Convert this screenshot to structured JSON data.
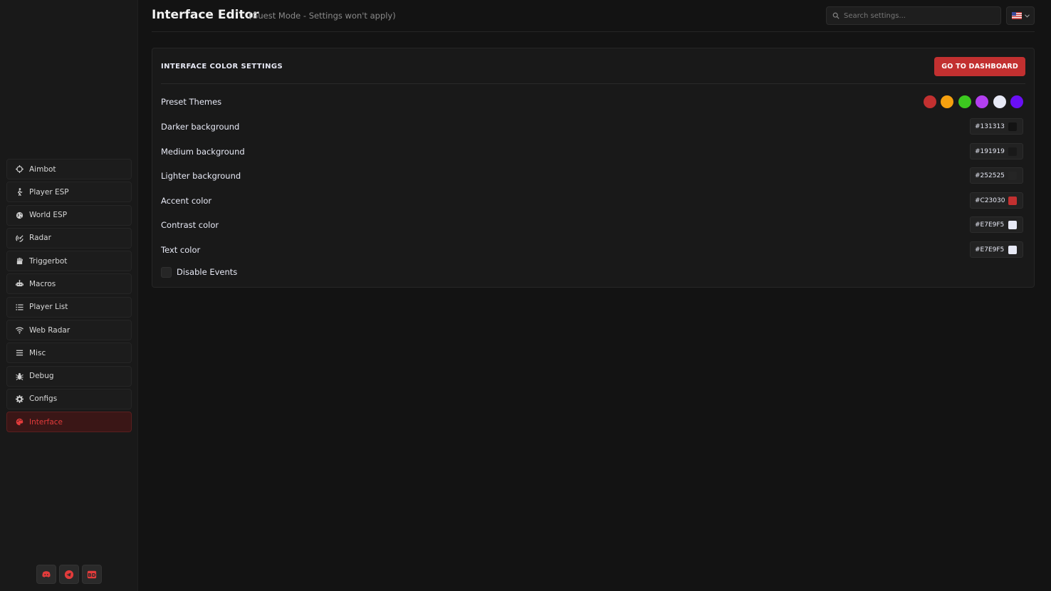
{
  "sidebar": {
    "items": [
      {
        "label": "Aimbot",
        "icon": "crosshair-icon"
      },
      {
        "label": "Player ESP",
        "icon": "person-icon"
      },
      {
        "label": "World ESP",
        "icon": "globe-icon"
      },
      {
        "label": "Radar",
        "icon": "radar-icon"
      },
      {
        "label": "Triggerbot",
        "icon": "hand-icon"
      },
      {
        "label": "Macros",
        "icon": "robot-icon"
      },
      {
        "label": "Player List",
        "icon": "list-icon"
      },
      {
        "label": "Web Radar",
        "icon": "wifi-icon"
      },
      {
        "label": "Misc",
        "icon": "menu-icon"
      },
      {
        "label": "Debug",
        "icon": "bug-icon"
      },
      {
        "label": "Configs",
        "icon": "gear-icon"
      },
      {
        "label": "Interface",
        "icon": "palette-icon",
        "active": true
      }
    ],
    "socials": [
      {
        "icon": "discord-icon"
      },
      {
        "icon": "telegram-icon"
      },
      {
        "icon": "bd-logo-icon",
        "text": "BD"
      }
    ]
  },
  "header": {
    "title": "Interface Editor",
    "subtitle": "(Guest Mode - Settings won't apply)",
    "search_placeholder": "Search settings...",
    "language_icon": "us-flag-icon"
  },
  "panel": {
    "title": "INTERFACE COLOR SETTINGS",
    "dashboard_button": "GO TO DASHBOARD",
    "preset_label": "Preset Themes",
    "presets": [
      "#c23030",
      "#f5a00f",
      "#3cc91f",
      "#b33ff0",
      "#e7e9f5",
      "#6a0ff5"
    ],
    "colors": [
      {
        "label": "Darker background",
        "value": "#131313"
      },
      {
        "label": "Medium background",
        "value": "#191919"
      },
      {
        "label": "Lighter background",
        "value": "#252525"
      },
      {
        "label": "Accent color",
        "value": "#C23030"
      },
      {
        "label": "Contrast color",
        "value": "#E7E9F5"
      },
      {
        "label": "Text color",
        "value": "#E7E9F5"
      }
    ],
    "disable_events_label": "Disable Events"
  }
}
